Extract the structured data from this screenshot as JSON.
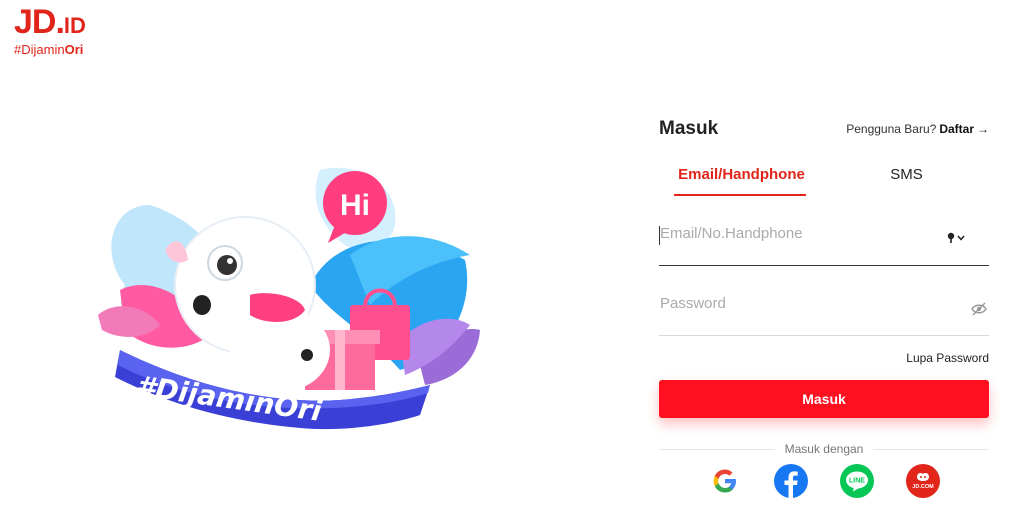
{
  "logo": {
    "brand": "JD",
    "dot": ".",
    "suffix": "ID",
    "tagline_prefix": "#Dijamin",
    "tagline_bold": "Ori"
  },
  "illustration": {
    "bubble_text": "Hi",
    "banner_text": "#DijaminOri"
  },
  "login": {
    "title": "Masuk",
    "signup_prompt": "Pengguna Baru?",
    "signup_link": "Daftar",
    "tabs": [
      {
        "label": "Email/Handphone",
        "active": true
      },
      {
        "label": "SMS",
        "active": false
      }
    ],
    "email_placeholder": "Email/No.Handphone",
    "password_placeholder": "Password",
    "forgot_label": "Lupa Password",
    "submit_label": "Masuk",
    "social_divider": "Masuk dengan",
    "social_providers": [
      {
        "name": "google",
        "icon": "google-icon"
      },
      {
        "name": "facebook",
        "icon": "facebook-icon"
      },
      {
        "name": "line",
        "icon": "line-icon",
        "label": "LINE"
      },
      {
        "name": "jd",
        "icon": "jd-com-icon",
        "label": "JD.COM"
      }
    ]
  },
  "colors": {
    "brand_red": "#e1251b",
    "button_red": "#ff1020",
    "facebook_blue": "#1877f2",
    "line_green": "#06c755"
  }
}
